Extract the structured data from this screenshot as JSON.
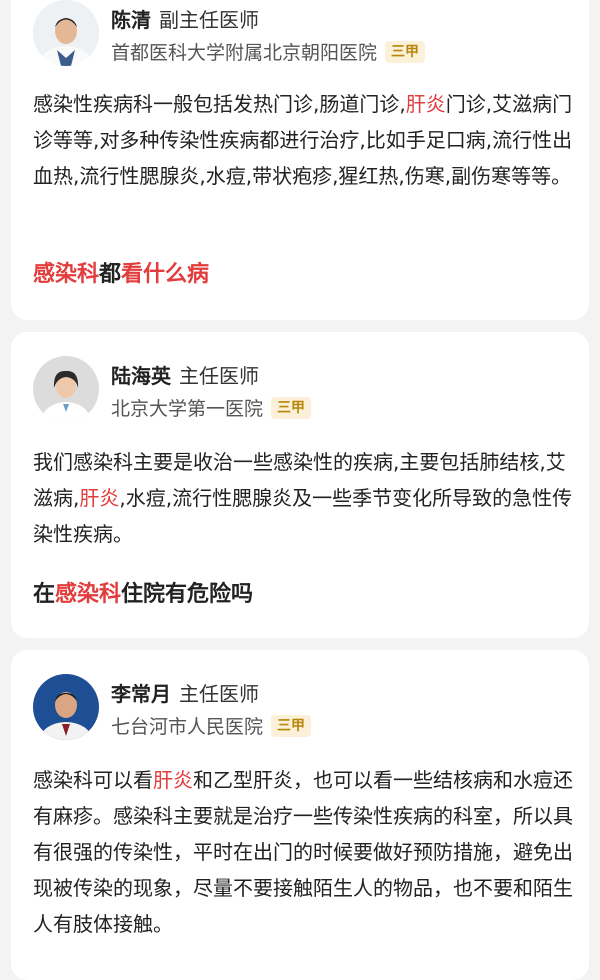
{
  "cards": [
    {
      "doctor_name": "陈清",
      "doctor_title": "副主任医师",
      "hospital": "首都医科大学附属北京朝阳医院",
      "badge": "三甲",
      "text_1": "感染性疾病科一般包括发热门诊,肠道门诊,",
      "text_hl": "肝炎",
      "text_2": "门诊,艾滋病门诊等等,对多种传染性疾病都进行治疗,比如手足口病,流行性出血热,流行性腮腺炎,水痘,带状疱疹,猩红热,伤寒,副伤寒等等。",
      "link_a": "感染科",
      "link_b": "都",
      "link_c": "看什么病"
    },
    {
      "doctor_name": "陆海英",
      "doctor_title": "主任医师",
      "hospital": "北京大学第一医院",
      "badge": "三甲",
      "text_1": "我们感染科主要是收治一些感染性的疾病,主要包括肺结核,艾滋病,",
      "text_hl": "肝炎",
      "text_2": ",水痘,流行性腮腺炎及一些季节变化所导致的急性传染性疾病。",
      "link_a": "在",
      "link_b": "感染科",
      "link_c": "住院有危险吗"
    },
    {
      "doctor_name": "李常月",
      "doctor_title": "主任医师",
      "hospital": "七台河市人民医院",
      "badge": "三甲",
      "text_1": "感染科可以看",
      "text_hl": "肝炎",
      "text_2": "和乙型肝炎，也可以看一些结核病和水痘还有麻疹。感染科主要就是治疗一些传染性疾病的科室，所以具有很强的传染性，平时在出门的时候要做好预防措施，避免出现被传染的现象，尽量不要接触陌生人的物品，也不要和陌生人有肢体接触。"
    }
  ],
  "colors": {
    "highlight": "#e23c3c",
    "badge_text": "#b8860b",
    "badge_bg": "#fbf0d8"
  },
  "icons": [
    "doctor-avatar"
  ]
}
